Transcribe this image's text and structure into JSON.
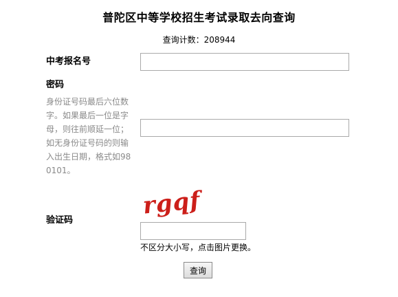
{
  "header": {
    "title": "普陀区中等学校招生考试录取去向查询",
    "counter_label": "查询计数：",
    "counter_value": "208944"
  },
  "form": {
    "exam_id": {
      "label": "中考报名号",
      "value": "",
      "placeholder": ""
    },
    "password": {
      "label": "密码",
      "hint": "身份证号码最后六位数字。如果最后一位是字母，则往前顺延一位；如无身份证号码的则输入出生日期，格式如980101。",
      "value": "",
      "placeholder": ""
    },
    "captcha": {
      "label": "验证码",
      "image_text": "rgqf",
      "value": "",
      "placeholder": "",
      "hint": "不区分大小写，点击图片更换。"
    },
    "submit_label": "查询"
  },
  "colors": {
    "captcha_text": "#cc1f1a",
    "hint_text": "#8a8a8a",
    "input_border": "#a9a9a9"
  }
}
